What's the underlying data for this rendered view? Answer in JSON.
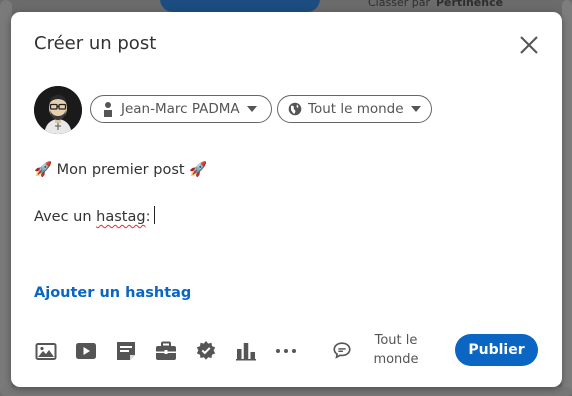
{
  "background": {
    "sort_label": "Classer par",
    "sort_value": "Pertinence"
  },
  "modal": {
    "title": "Créer un post"
  },
  "author": {
    "name": "Jean-Marc PADMA"
  },
  "visibility": {
    "label": "Tout le monde"
  },
  "editor": {
    "line1": "🚀 Mon premier post 🚀",
    "line2_prefix": "Avec un ",
    "line2_misspelled": "hastag",
    "line2_suffix": ":"
  },
  "actions": {
    "add_hashtag": "Ajouter un hashtag",
    "comment_audience_line1": "Tout le",
    "comment_audience_line2": "monde",
    "publish": "Publier"
  },
  "toolbar": {
    "icons": [
      "photo-icon",
      "video-icon",
      "document-icon",
      "job-icon",
      "celebrate-icon",
      "poll-icon",
      "more-icon",
      "comment-icon"
    ]
  },
  "colors": {
    "accent": "#0a66c2",
    "text": "#333333",
    "muted": "#555555",
    "spellcheck": "#e0312b"
  }
}
